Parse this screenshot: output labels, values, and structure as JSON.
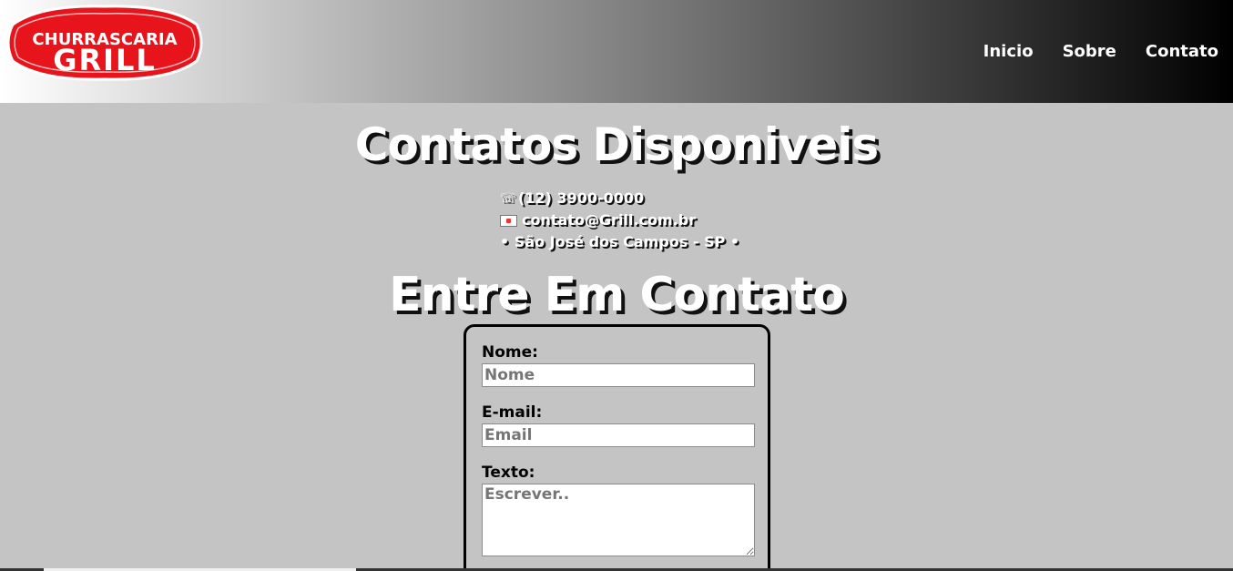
{
  "logo": {
    "line1": "CHURRASCARIA",
    "line2": "GRILL",
    "bg_color": "#e8141c"
  },
  "nav": {
    "items": [
      "Inicio",
      "Sobre",
      "Contato"
    ]
  },
  "contacts": {
    "heading": "Contatos Disponiveis",
    "phone_icon": "telephone-icon",
    "phone": "(12) 3900-0000",
    "email_icon": "envelope-icon",
    "email": "contato@Grill.com.br",
    "location": "• São José dos Campos - SP •"
  },
  "form": {
    "heading": "Entre Em Contato",
    "name_label": "Nome:",
    "name_placeholder": "Nome",
    "email_label": "E-mail:",
    "email_placeholder": "Email",
    "text_label": "Texto:",
    "text_placeholder": "Escrever.."
  },
  "colors": {
    "background": "#c4c4c4",
    "logo_red": "#e8141c"
  }
}
